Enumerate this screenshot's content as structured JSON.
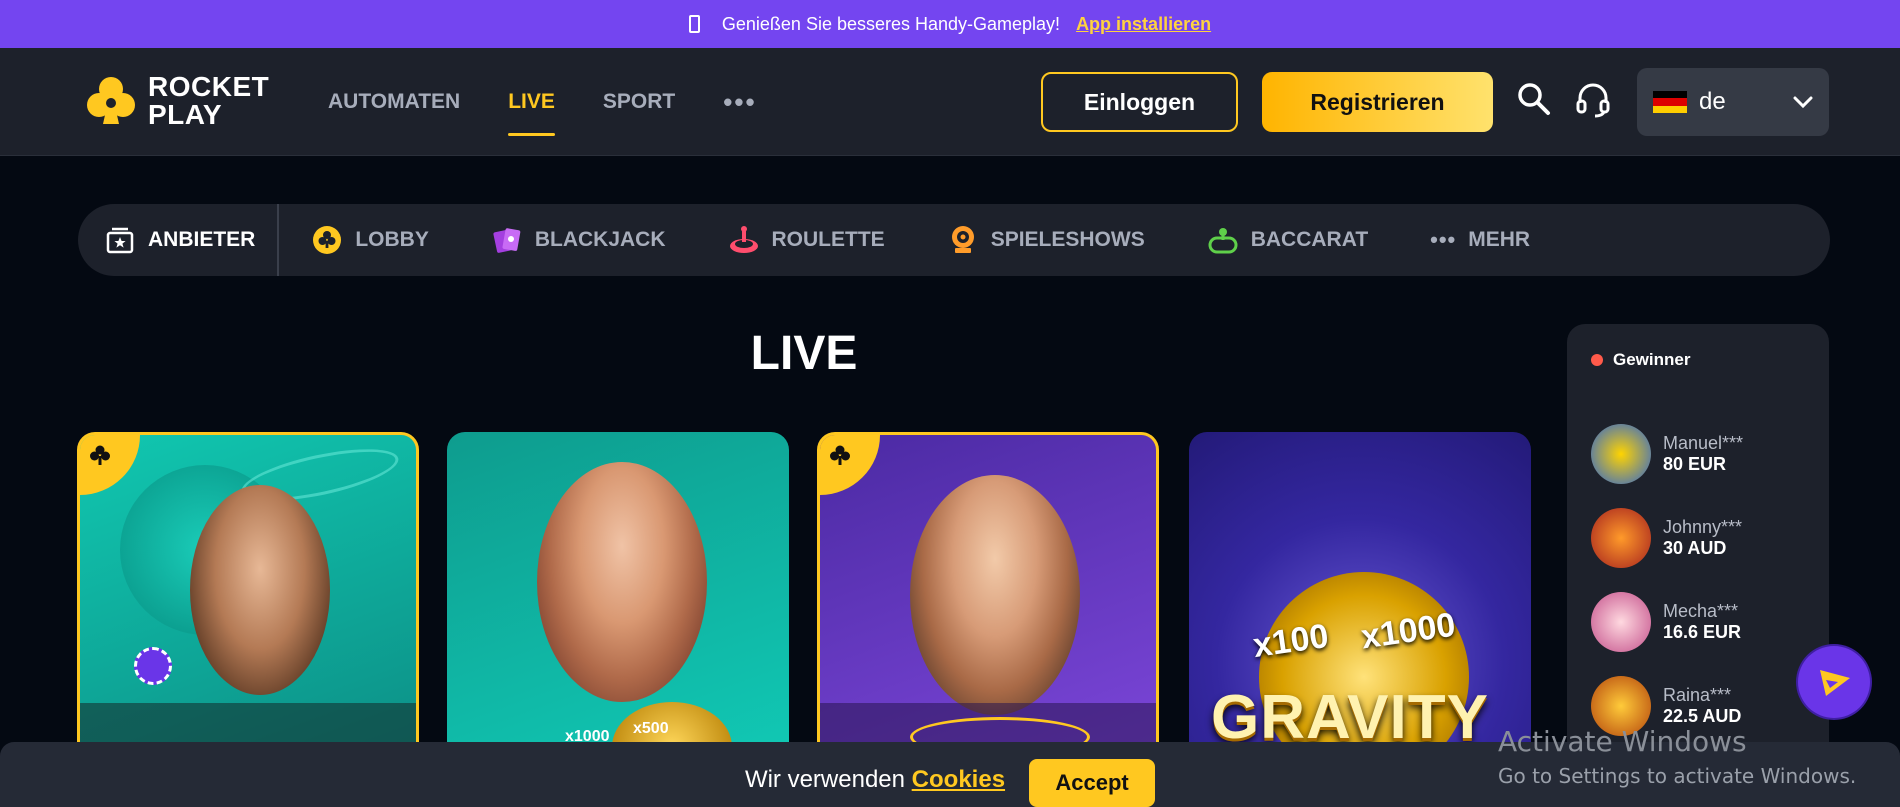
{
  "topbar": {
    "message": "Genießen Sie besseres Handy-Gameplay!",
    "link": "App installieren",
    "icon": "phone-icon"
  },
  "logo": {
    "line1": "ROCKET",
    "line2": "PLAY"
  },
  "nav": [
    {
      "label": "AUTOMATEN"
    },
    {
      "label": "LIVE",
      "active": true
    },
    {
      "label": "SPORT"
    }
  ],
  "header": {
    "login": "Einloggen",
    "register": "Registrieren",
    "language": "de"
  },
  "categories": [
    {
      "label": "ANBIETER",
      "icon": "provider-icon"
    },
    {
      "label": "LOBBY",
      "icon": "club-icon"
    },
    {
      "label": "BLACKJACK",
      "icon": "cards-icon"
    },
    {
      "label": "ROULETTE",
      "icon": "roulette-icon"
    },
    {
      "label": "SPIELESHOWS",
      "icon": "game-show-icon"
    },
    {
      "label": "BACCARAT",
      "icon": "baccarat-icon"
    },
    {
      "label": "MEHR",
      "icon": "more-icon"
    }
  ],
  "page_title": "LIVE",
  "cards": [
    {
      "name": "live-game-1",
      "exclusive": true
    },
    {
      "name": "live-game-2",
      "exclusive": false,
      "badges": [
        "x1000",
        "x500"
      ]
    },
    {
      "name": "live-game-3",
      "exclusive": true
    },
    {
      "name": "gravity-game",
      "exclusive": false,
      "text": "GRAVITY",
      "badges": [
        "x100",
        "x1000"
      ]
    }
  ],
  "winners": {
    "title": "Gewinner",
    "items": [
      {
        "name": "Manuel***",
        "amount": "80 EUR"
      },
      {
        "name": "Johnny***",
        "amount": "30 AUD"
      },
      {
        "name": "Mecha***",
        "amount": "16.6 EUR"
      },
      {
        "name": "Raina***",
        "amount": "22.5 AUD"
      }
    ]
  },
  "cookie": {
    "text": "Wir verwenden",
    "link": "Cookies",
    "accept": "Accept"
  },
  "watermark": {
    "line1": "Activate Windows",
    "line2": "Go to Settings to activate Windows."
  },
  "colors": {
    "accent": "#ffc820",
    "topbar": "#7445f0",
    "header": "#1d212b",
    "background": "#040912"
  }
}
